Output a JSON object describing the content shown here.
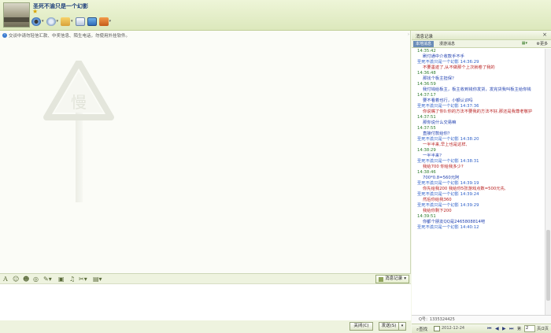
{
  "header": {
    "contact_name": "圣死不渝只是一个幻影"
  },
  "notice": {
    "text": "交谈中请勿轻信汇款、中奖信息、陌生电话，勿使用外挂软件。"
  },
  "watermark": {
    "sign_text": "慢"
  },
  "input_toolbar": {
    "history_label": "消息记录"
  },
  "bottom": {
    "close_label": "关闭(C)",
    "send_label": "发送(S)"
  },
  "history": {
    "title": "消息记录",
    "tabs": {
      "local": "本地消息",
      "roaming": "漫游消息",
      "more": "更多"
    },
    "messages": [
      {
        "head": "14:35:42",
        "side": "right",
        "body": "刷付通中介收款手不手",
        "color": "blue"
      },
      {
        "head": "圣死不渝只是一个幻影 14:36:29",
        "side": "left",
        "body": "不要墨迹了,从不做那个上次就卷了我的",
        "color": "red"
      },
      {
        "head": "14:36:48",
        "side": "right",
        "body": "那找个板主担保？",
        "color": "blue"
      },
      {
        "head": "14:36:59",
        "side": "right",
        "body": "我付钱给板主，板主收到钱你发货，发完货我叫板主给你钱",
        "color": "blue"
      },
      {
        "head": "14:37:17",
        "side": "right",
        "body": "要不看着也行，小额认识吗",
        "color": "blue"
      },
      {
        "head": "圣死不渝只是一个幻影 14:37:36",
        "side": "left",
        "body": "你说嘴了你0.你的方法不要我的方法不好,那还是我尊老敬护",
        "color": "red"
      },
      {
        "head": "14:37:51",
        "side": "right",
        "body": "那你说什么交易嘛",
        "color": "blue"
      },
      {
        "head": "14:37:55",
        "side": "right",
        "body": "直接付款给你？",
        "color": "blue"
      },
      {
        "head": "圣死不渝只是一个幻影 14:38:20",
        "side": "left",
        "body": "一半半来,早上也是这样,",
        "color": "red"
      },
      {
        "head": "14:38:29",
        "side": "right",
        "body": "一半半来？",
        "color": "blue"
      },
      {
        "head": "圣死不渝只是一个幻影 14:38:31",
        "side": "left",
        "body": "我给700 你给我多少?",
        "color": "red"
      },
      {
        "head": "14:38:46",
        "side": "right",
        "body": "700*0.8=560元阿",
        "color": "blue"
      },
      {
        "head": "圣死不渝只是一个幻影 14:39:19",
        "side": "left",
        "body": "你先给我200 我给你5张游戏点数=500元先,",
        "color": "red"
      },
      {
        "head": "圣死不渝只是一个幻影 14:39:24",
        "side": "left",
        "body": "然后你给我360",
        "color": "red"
      },
      {
        "head": "圣死不渝只是一个幻影 14:39:29",
        "side": "left",
        "body": "我给你剩下200",
        "color": "red"
      },
      {
        "head": "14:39:51",
        "side": "right",
        "body": "你都个朋友QQ是2465808814吧",
        "color": "blue"
      },
      {
        "head": "圣死不渝只是一个幻影 14:40:12",
        "side": "left",
        "body": "",
        "color": "red"
      }
    ],
    "account": "Q号：1335324425",
    "search_label": "查找",
    "date": "2012-12-24",
    "page_label": "第",
    "page_value": "2",
    "page_total": "页/2页"
  }
}
